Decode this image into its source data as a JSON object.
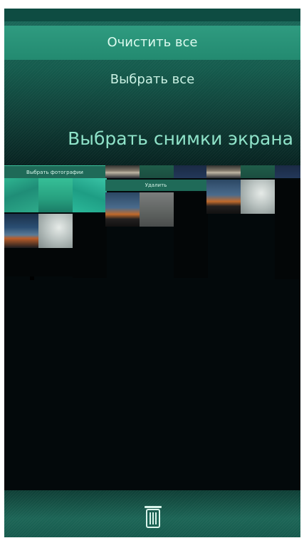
{
  "pulley_menu": {
    "items": [
      {
        "label": "Очистить все"
      },
      {
        "label": "Выбрать все"
      }
    ]
  },
  "header": {
    "title": "Выбрать снимки экрана"
  },
  "context_labels": {
    "select_photos": "Выбрать фотографии",
    "delete": "Удалить"
  },
  "toolbar": {
    "delete_icon": "trash-icon"
  },
  "colors": {
    "accent": "#2f9b80",
    "highlight_text": "#8fe3c9",
    "background": "#03090b"
  }
}
